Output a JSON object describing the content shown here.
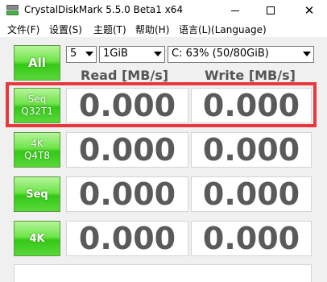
{
  "window": {
    "title": "CrystalDiskMark 5.5.0 Beta1 x64"
  },
  "menu": [
    "文件(F)",
    "设置(S)",
    "主题(T)",
    "帮助(H)",
    "语言(L)(Language)"
  ],
  "controls": {
    "all_label": "All",
    "test_count": "5",
    "test_size": "1GiB",
    "drive": "C: 63% (50/80GiB)"
  },
  "headers": {
    "read": "Read [MB/s]",
    "write": "Write [MB/s]"
  },
  "rows": [
    {
      "line1": "Seq",
      "line2": "Q32T1",
      "read": "0.000",
      "write": "0.000"
    },
    {
      "line1": "4K",
      "line2": "Q4T8",
      "read": "0.000",
      "write": "0.000"
    },
    {
      "line1": "Seq",
      "line2": "",
      "read": "0.000",
      "write": "0.000"
    },
    {
      "line1": "4K",
      "line2": "",
      "read": "0.000",
      "write": "0.000"
    }
  ],
  "colors": {
    "highlight": "#e8383d",
    "button_green": "#34c818",
    "result_text": "#5a5a5a"
  }
}
